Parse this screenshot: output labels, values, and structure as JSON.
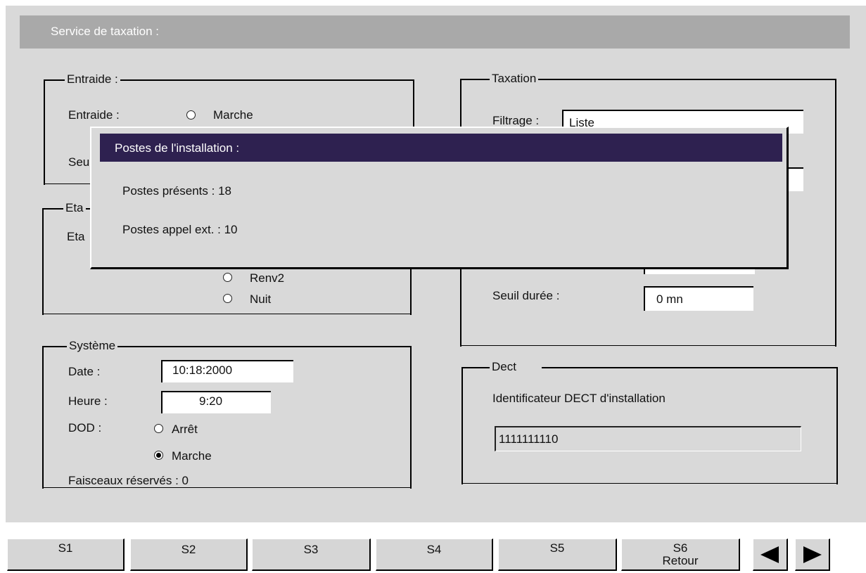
{
  "header": {
    "title": "Service de taxation :"
  },
  "entraide": {
    "legend": "Entraide :",
    "entraide_label": "Entraide :",
    "marche_label": "Marche",
    "seuil_partial": "Seu"
  },
  "etat": {
    "legend_partial": "Eta",
    "row_partial": "Eta",
    "options": [
      {
        "label": "Renv2",
        "selected": false
      },
      {
        "label": "Nuit",
        "selected": false
      }
    ]
  },
  "systeme": {
    "legend": "Système",
    "date_label": "Date :",
    "date_value": "10:18:2000",
    "heure_label": "Heure :",
    "heure_value": "9:20",
    "dod_label": "DOD :",
    "dod_options": [
      {
        "label": "Arrêt",
        "selected": false
      },
      {
        "label": "Marche",
        "selected": true
      }
    ],
    "faisceaux": "Faisceaux réservés : 0"
  },
  "taxation": {
    "legend": "Taxation",
    "filtrage_label": "Filtrage :",
    "filtrage_value": "Liste",
    "seuil_duree_label": "Seuil durée :",
    "seuil_duree_value": "0  mn"
  },
  "dect": {
    "legend": "Dect",
    "description": "Identificateur DECT d'installation",
    "value": "1111111110"
  },
  "popup": {
    "title": "Postes de l'installation :",
    "postes_presents": "Postes présents : 18",
    "postes_appel": "Postes appel ext. : 10"
  },
  "function_keys": [
    {
      "label": "S1",
      "sub": ""
    },
    {
      "label": "S2",
      "sub": ""
    },
    {
      "label": "S3",
      "sub": ""
    },
    {
      "label": "S4",
      "sub": ""
    },
    {
      "label": "S5",
      "sub": ""
    },
    {
      "label": "S6",
      "sub": "Retour"
    }
  ],
  "nav": {
    "prev_icon": "left-arrow-icon",
    "next_icon": "right-arrow-icon"
  },
  "colors": {
    "popup_title_bg": "#2e2150",
    "title_bar_bg": "#a9a9a9",
    "panel_bg": "#d9d9d9"
  }
}
